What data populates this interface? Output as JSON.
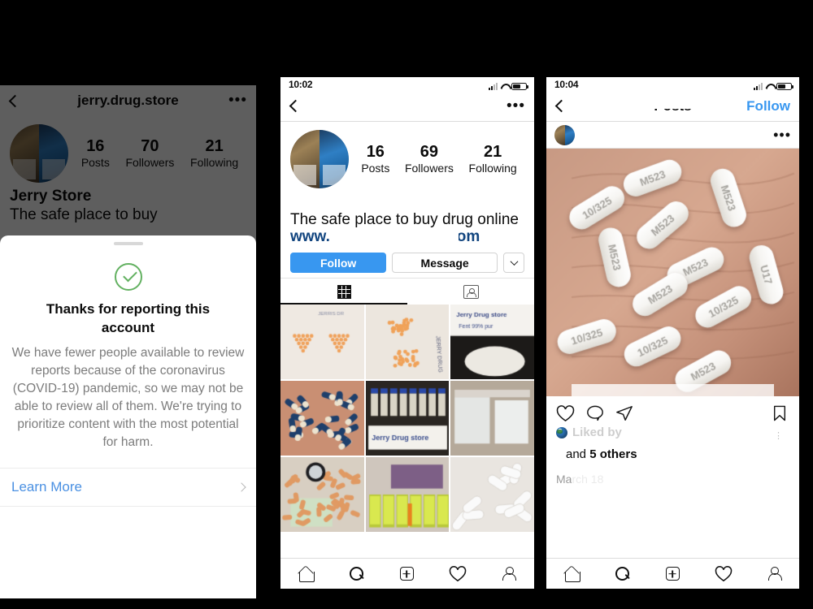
{
  "panels": {
    "left": {
      "name": "instagram-profile-report-confirmation",
      "header": {
        "username": "jerry.drug.store",
        "back_icon": "chevron-left-icon",
        "more_icon": "ellipsis-icon"
      },
      "stats": [
        {
          "num": "16",
          "label": "Posts"
        },
        {
          "num": "70",
          "label": "Followers"
        },
        {
          "num": "21",
          "label": "Following"
        }
      ],
      "bio": {
        "name": "Jerry Store",
        "desc": "The safe place to buy"
      },
      "sheet": {
        "check_icon": "green-check-circle-icon",
        "title": "Thanks for reporting this account",
        "body": "We have fewer people available to review reports because of the coronavirus (COVID-19) pandemic, so we may not be able to review all of them. We're trying to prioritize content with the most potential for harm.",
        "learn_more": "Learn More",
        "chevron_icon": "chevron-right-icon"
      }
    },
    "middle": {
      "name": "instagram-profile-grid",
      "status": {
        "time": "10:02",
        "signal_icon": "signal-bars-icon",
        "wifi_icon": "wifi-icon",
        "battery_icon": "battery-icon"
      },
      "header": {
        "username": "",
        "back_icon": "chevron-left-icon",
        "more_icon": "ellipsis-icon"
      },
      "stats": [
        {
          "num": "16",
          "label": "Posts"
        },
        {
          "num": "69",
          "label": "Followers"
        },
        {
          "num": "21",
          "label": "Following"
        }
      ],
      "bio": {
        "name": "",
        "desc": "The safe place to buy drug online",
        "link_prefix": "www.",
        "link_suffix": ".com"
      },
      "buttons": {
        "follow": "Follow",
        "message": "Message",
        "more_icon": "chevron-down-icon"
      },
      "tabs": [
        {
          "icon": "grid-icon",
          "active": true
        },
        {
          "icon": "tagged-person-icon",
          "active": false
        }
      ],
      "grid": [
        "orange-pills-two-triangles-on-paper",
        "orange-pills-piles-with-handwritten-note",
        "white-powder-in-pan-with-jerry-drug-store-note",
        "blue-white-capsules-in-palm",
        "vials-row-with-jerry-drug-store-note",
        "clear-bags-of-crystals",
        "orange-capsules-green-tablets-with-watch",
        "yellow-capsule-jars-row",
        "white-oblong-pills-in-palm"
      ],
      "bottom_nav": [
        "home-icon",
        "search-icon",
        "add-post-icon",
        "heart-icon",
        "profile-icon"
      ]
    },
    "right": {
      "name": "instagram-post-detail",
      "status": {
        "time": "10:04",
        "signal_icon": "signal-bars-icon",
        "wifi_icon": "wifi-icon",
        "battery_icon": "battery-icon"
      },
      "header": {
        "title": "Posts",
        "back_icon": "chevron-left-icon",
        "follow": "Follow"
      },
      "post": {
        "more_icon": "ellipsis-icon",
        "image": "white-oblong-pills-M523-10-325-in-palm",
        "actions": [
          "heart-icon",
          "comment-icon",
          "share-icon",
          "bookmark-icon"
        ],
        "liked_by_prefix": "Liked by",
        "liked_by_suffix_and": "and",
        "liked_by_count": "5 others",
        "date": "March 18"
      },
      "bottom_nav": [
        "home-icon",
        "search-icon",
        "add-post-icon",
        "heart-icon",
        "profile-icon"
      ]
    }
  },
  "colors": {
    "accent_blue": "#3897f0",
    "link_blue": "#4a90e2",
    "success_green": "#63b161",
    "background": "#000000",
    "surface": "#ffffff"
  }
}
